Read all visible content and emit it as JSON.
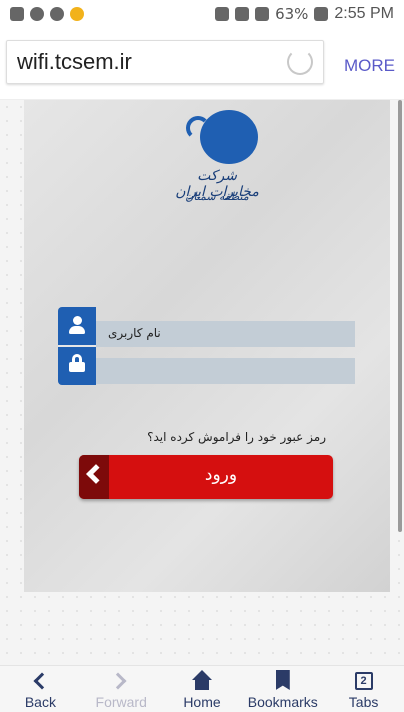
{
  "status_bar": {
    "battery": "63%",
    "time": "2:55 PM"
  },
  "browser": {
    "url": "wifi.tcsem.ir",
    "more_label": "MORE"
  },
  "login_form": {
    "logo_text_line1": "شرکت مخابرات ایران",
    "logo_text_line2": "منطقه سمنان",
    "username_placeholder": "نام کاربری",
    "password_placeholder": "",
    "forgot_password": "رمز عبور خود را فراموش کرده اید؟",
    "login_button": "ورود",
    "accent_color": "#1f5fb2",
    "button_color": "#d50f0f"
  },
  "bottom_nav": {
    "back": "Back",
    "forward": "Forward",
    "home": "Home",
    "bookmarks": "Bookmarks",
    "tabs": "Tabs",
    "tabs_count": "2"
  }
}
